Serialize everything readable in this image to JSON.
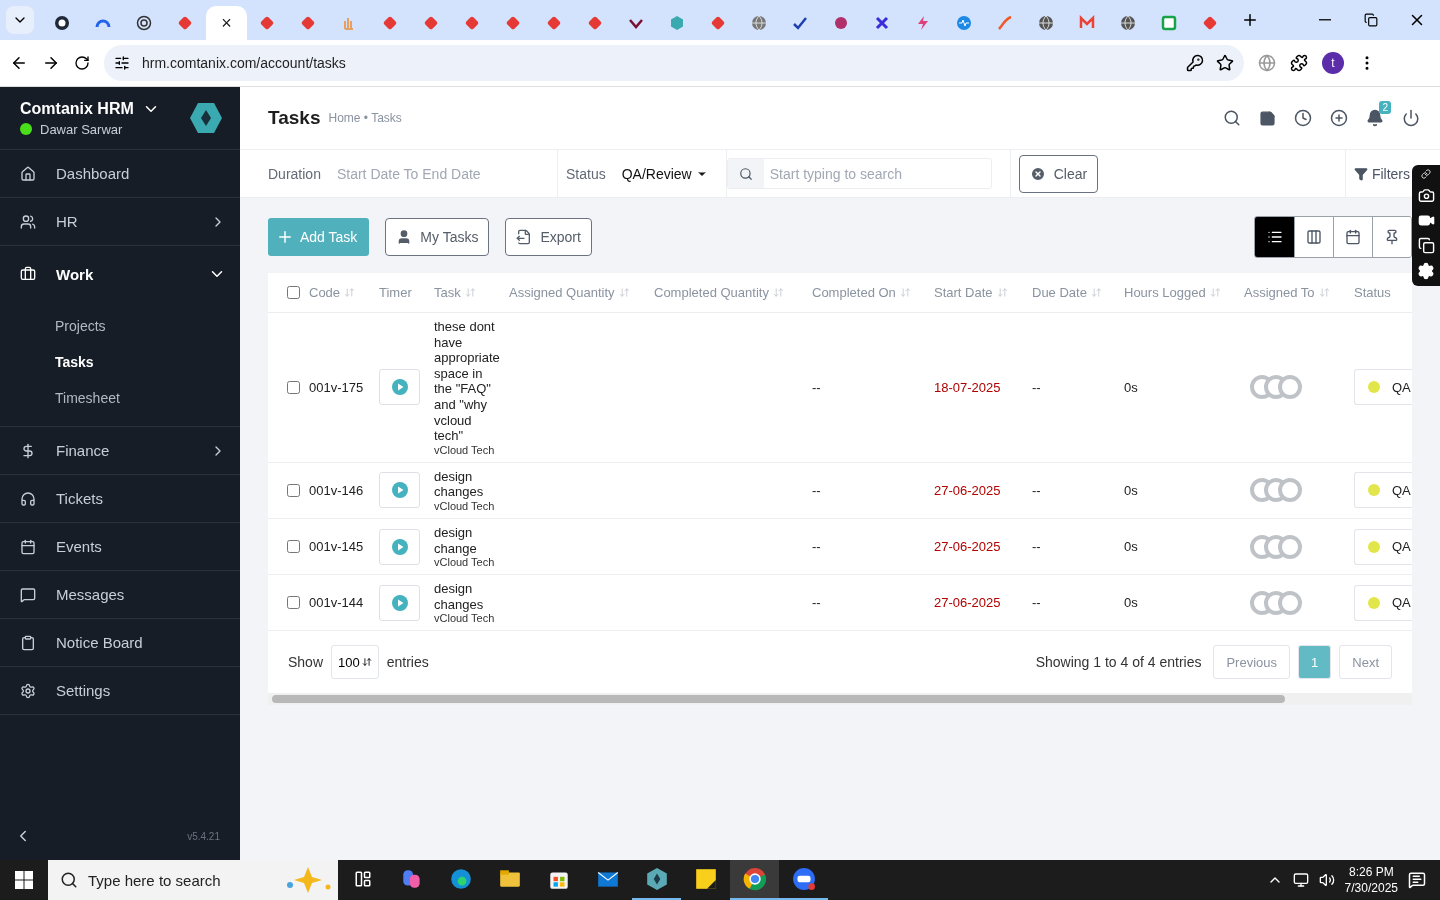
{
  "browser": {
    "tabs": [
      {
        "kind": "ring",
        "color": "#1f2937",
        "selected": false
      },
      {
        "kind": "gauge",
        "color": "#2563eb",
        "selected": false
      },
      {
        "kind": "swirl",
        "color": "#333333",
        "selected": false
      },
      {
        "kind": "tag",
        "color": "#e53935",
        "selected": false
      },
      {
        "kind": "blank",
        "selected": true,
        "close": "×"
      },
      {
        "kind": "tag",
        "color": "#e53935",
        "selected": false
      },
      {
        "kind": "tag",
        "color": "#e53935",
        "selected": false
      },
      {
        "kind": "hand",
        "color": "#e8a060",
        "selected": false
      },
      {
        "kind": "tag",
        "color": "#e53935",
        "selected": false
      },
      {
        "kind": "tag",
        "color": "#e53935",
        "selected": false
      },
      {
        "kind": "tag",
        "color": "#e53935",
        "selected": false
      },
      {
        "kind": "tag",
        "color": "#e53935",
        "selected": false
      },
      {
        "kind": "tag",
        "color": "#e53935",
        "selected": false
      },
      {
        "kind": "tag",
        "color": "#e53935",
        "selected": false
      },
      {
        "kind": "vmark",
        "color": "#7a1030",
        "selected": false
      },
      {
        "kind": "hexagon",
        "color": "#3aa9b0",
        "selected": false
      },
      {
        "kind": "tag",
        "color": "#e53935",
        "selected": false
      },
      {
        "kind": "globe",
        "color": "#777777",
        "selected": false
      },
      {
        "kind": "check",
        "color": "#1e40af",
        "selected": false
      },
      {
        "kind": "ball",
        "color": "#b0306a",
        "selected": false
      },
      {
        "kind": "cross",
        "color": "#3b2bd8",
        "selected": false
      },
      {
        "kind": "bolt",
        "color": "#e0407a",
        "selected": false
      },
      {
        "kind": "pulse",
        "color": "#1e88e5",
        "selected": false
      },
      {
        "kind": "swoosh",
        "color": "#f05a28",
        "selected": false
      },
      {
        "kind": "globe",
        "color": "#555555",
        "selected": false
      },
      {
        "kind": "mail",
        "color": "#ea4335",
        "selected": false
      },
      {
        "kind": "globe",
        "color": "#555555",
        "selected": false
      },
      {
        "kind": "square",
        "color": "#16a34a",
        "selected": false
      },
      {
        "kind": "tag",
        "color": "#e53935",
        "selected": false
      }
    ],
    "url": "hrm.comtanix.com/account/tasks",
    "profile": "t"
  },
  "sidebar": {
    "brand": "Comtanix HRM",
    "user": "Dawar Sarwar",
    "online": true,
    "items": [
      {
        "label": "Dashboard"
      },
      {
        "label": "HR",
        "expanded": false
      },
      {
        "label": "Work",
        "expanded": true,
        "children": [
          {
            "label": "Projects",
            "selected": false
          },
          {
            "label": "Tasks",
            "selected": true
          },
          {
            "label": "Timesheet",
            "selected": false
          }
        ]
      },
      {
        "label": "Finance",
        "expanded": false
      },
      {
        "label": "Tickets"
      },
      {
        "label": "Events"
      },
      {
        "label": "Messages"
      },
      {
        "label": "Notice Board"
      },
      {
        "label": "Settings"
      }
    ],
    "version": "v5.4.21"
  },
  "header": {
    "title": "Tasks",
    "breadcrumb": "Home • Tasks",
    "notifications": "2"
  },
  "filters": {
    "duration_label": "Duration",
    "duration_placeholder": "Start Date To End Date",
    "status_label": "Status",
    "status_value": "QA/Review",
    "search_placeholder": "Start typing to search",
    "clear": "Clear",
    "filters": "Filters"
  },
  "actions": [
    "Add Task",
    "My Tasks",
    "Export"
  ],
  "views": [
    {
      "selected": true
    },
    {
      "selected": false
    },
    {
      "selected": false
    },
    {
      "selected": false
    }
  ],
  "table": {
    "all_checked": false,
    "columns": [
      "Code",
      "Timer",
      "Task",
      "Assigned Quantity",
      "Completed Quantity",
      "Completed On",
      "Start Date",
      "Due Date",
      "Hours Logged",
      "Assigned To",
      "Status"
    ],
    "rows": [
      {
        "checked": false,
        "code": "001v-175",
        "task": "these dont have appropriate space in the \"FAQ\" and \"why vcloud tech\"",
        "project": "vCloud Tech",
        "completed_on": "--",
        "start_date": "18-07-2025",
        "due_date": "--",
        "hours": "0s",
        "status": "QA",
        "color": "#e2e64a"
      },
      {
        "checked": false,
        "code": "001v-146",
        "task": "design changes",
        "project": "vCloud Tech",
        "completed_on": "--",
        "start_date": "27-06-2025",
        "due_date": "--",
        "hours": "0s",
        "status": "QA",
        "color": "#e2e64a"
      },
      {
        "checked": false,
        "code": "001v-145",
        "task": "design change",
        "project": "vCloud Tech",
        "completed_on": "--",
        "start_date": "27-06-2025",
        "due_date": "--",
        "hours": "0s",
        "status": "QA",
        "color": "#e2e64a"
      },
      {
        "checked": false,
        "code": "001v-144",
        "task": "design changes",
        "project": "vCloud Tech",
        "completed_on": "--",
        "start_date": "27-06-2025",
        "due_date": "--",
        "hours": "0s",
        "status": "QA",
        "color": "#e2e64a"
      }
    ]
  },
  "footer": {
    "show": "Show",
    "page_size": "100",
    "entries": "entries",
    "info": "Showing 1 to 4 of 4 entries",
    "previous": "Previous",
    "pages": [
      {
        "label": "1",
        "selected": true
      }
    ],
    "next": "Next"
  },
  "taskbar": {
    "search_placeholder": "Type here to search",
    "apps": [
      {
        "running": false,
        "selected": false
      },
      {
        "running": false,
        "selected": false
      },
      {
        "running": false,
        "selected": false
      },
      {
        "running": false,
        "selected": false
      },
      {
        "running": false,
        "selected": false
      },
      {
        "running": true,
        "selected": false
      },
      {
        "running": false,
        "selected": false
      },
      {
        "running": true,
        "selected": true
      },
      {
        "running": true,
        "selected": false
      }
    ],
    "time": "8:26 PM",
    "date": "7/30/2025"
  }
}
